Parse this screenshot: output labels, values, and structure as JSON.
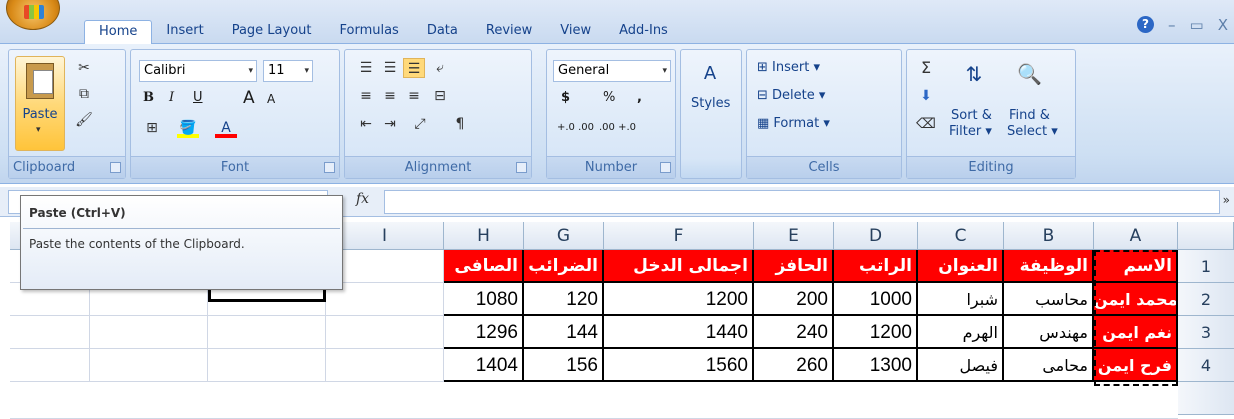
{
  "ribbon": {
    "tabs": [
      "Home",
      "Insert",
      "Page Layout",
      "Formulas",
      "Data",
      "Review",
      "View",
      "Add-Ins"
    ],
    "active_tab": "Home",
    "window_controls": [
      "?",
      "–",
      "▭",
      "X"
    ],
    "clipboard": {
      "label": "Clipboard",
      "paste": "Paste"
    },
    "font": {
      "label": "Font",
      "name": "Calibri",
      "size": "11",
      "bold": "B",
      "italic": "I",
      "underline": "U",
      "grow": "A",
      "shrink": "A"
    },
    "alignment": {
      "label": "Alignment"
    },
    "number": {
      "label": "Number",
      "format": "General",
      "currency": "$",
      "percent": "%",
      "comma": ",",
      "inc_dec": "+.0 .00",
      "dec_dec": ".00 +.0"
    },
    "styles": {
      "label": "Styles"
    },
    "cells": {
      "label": "Cells",
      "insert": "Insert",
      "delete": "Delete",
      "format": "Format"
    },
    "editing": {
      "label": "Editing",
      "sort": "Sort &",
      "filter": "Filter",
      "find": "Find &",
      "select": "Select"
    }
  },
  "formula_bar": {
    "fx": "fx"
  },
  "tooltip": {
    "title": "Paste (Ctrl+V)",
    "body": "Paste the contents of the Clipboard."
  },
  "sheet": {
    "columns": [
      "I",
      "H",
      "G",
      "F",
      "E",
      "D",
      "C",
      "B",
      "A"
    ],
    "rows": [
      "1",
      "2",
      "3",
      "4"
    ],
    "headers": {
      "net": "الصافى",
      "tax": "الضرائب",
      "gross": "اجمالى الدخل",
      "incentive": "الحافز",
      "salary": "الراتب",
      "address": "العنوان",
      "job": "الوظيفة",
      "name": "الاسم"
    },
    "data": [
      {
        "net": "1080",
        "tax": "120",
        "gross": "1200",
        "incentive": "200",
        "salary": "1000",
        "address": "شبرا",
        "job": "محاسب",
        "name": "محمد ايمن"
      },
      {
        "net": "1296",
        "tax": "144",
        "gross": "1440",
        "incentive": "240",
        "salary": "1200",
        "address": "الهرم",
        "job": "مهندس",
        "name": "نغم ايمن"
      },
      {
        "net": "1404",
        "tax": "156",
        "gross": "1560",
        "incentive": "260",
        "salary": "1300",
        "address": "فيصل",
        "job": "محامى",
        "name": "فرح ايمن"
      }
    ]
  }
}
